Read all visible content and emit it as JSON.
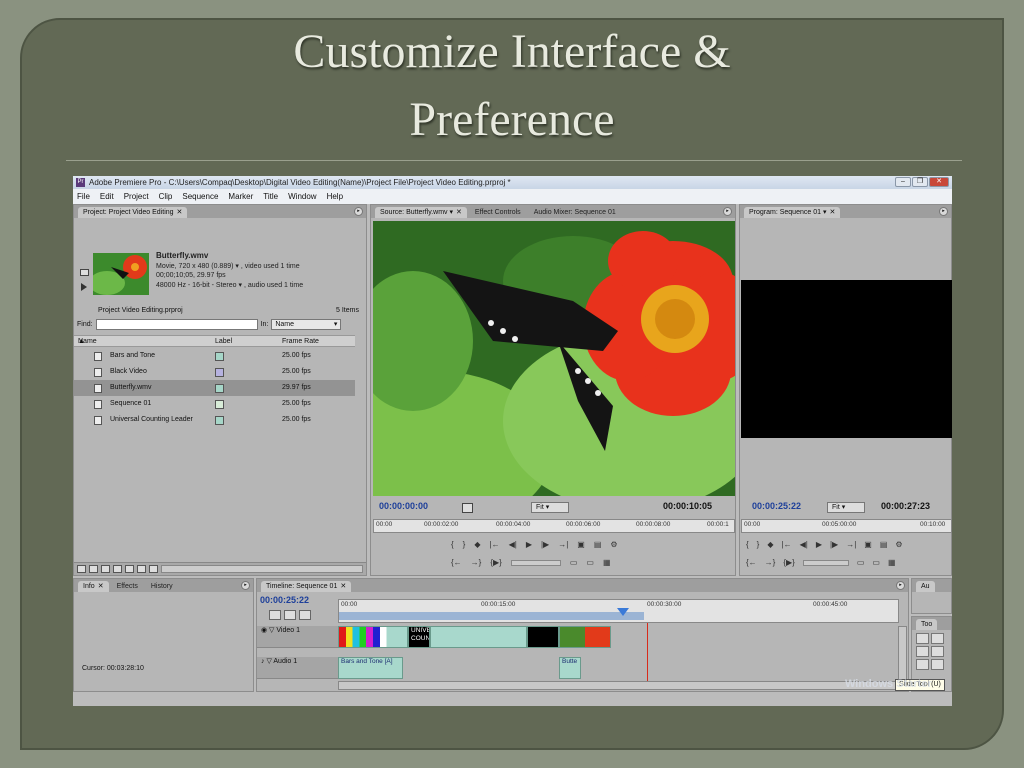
{
  "slide": {
    "title_line1": "Customize Interface &",
    "title_line2": "Preference"
  },
  "app": {
    "title_bar": "Adobe Premiere Pro - C:\\Users\\Compaq\\Desktop\\Digital Video Editing(Name)\\Project File\\Project Video Editing.prproj *",
    "icon_text": "Pr",
    "menu": [
      "File",
      "Edit",
      "Project",
      "Clip",
      "Sequence",
      "Marker",
      "Title",
      "Window",
      "Help"
    ]
  },
  "project_panel": {
    "tab": "Project: Project Video Editing",
    "clip_name": "Butterfly.wmv",
    "clip_line1": "Movie, 720 x 480 (0.889)  ▾  , video used 1 time",
    "clip_line2": "00;00;10;05, 29.97 fps",
    "clip_line3": "48000 Hz - 16-bit - Stereo  ▾  , audio used 1 time",
    "project_file": "Project Video Editing.prproj",
    "item_count": "5 Items",
    "find_label": "Find:",
    "in_label": "In:",
    "in_value": "Name",
    "col_name": "Name",
    "col_label": "Label",
    "col_frame_rate": "Frame Rate",
    "items": [
      {
        "name": "Bars and Tone",
        "fps": "25.00 fps",
        "color": "#a6d6c8"
      },
      {
        "name": "Black Video",
        "fps": "25.00 fps",
        "color": "#b6b2e0"
      },
      {
        "name": "Butterfly.wmv",
        "fps": "29.97 fps",
        "color": "#a6d6c8"
      },
      {
        "name": "Sequence 01",
        "fps": "25.00 fps",
        "color": "#d8ecd8"
      },
      {
        "name": "Universal Counting Leader",
        "fps": "25.00 fps",
        "color": "#a6d6c8"
      }
    ]
  },
  "source_monitor": {
    "tabs": [
      "Source: Butterfly.wmv",
      "Effect Controls",
      "Audio Mixer: Sequence 01"
    ],
    "timecode_current": "00:00:00:00",
    "fit": "Fit",
    "timecode_duration": "00:00:10:05",
    "ruler": [
      "00:00",
      "00:00:02:00",
      "00:00:04:00",
      "00:00:06:00",
      "00:00:08:00",
      "00:00:1"
    ]
  },
  "program_monitor": {
    "tab": "Program: Sequence 01",
    "timecode_current": "00:00:25:22",
    "fit": "Fit",
    "timecode_duration": "00:00:27:23",
    "ruler": [
      "00:00",
      "00:05:00:00",
      "00:10:00"
    ]
  },
  "info_panel": {
    "tabs": [
      "Info",
      "Effects",
      "History"
    ],
    "cursor": "Cursor: 00:03:28:10"
  },
  "timeline": {
    "tab": "Timeline: Sequence 01",
    "timecode": "00:00:25:22",
    "ruler": [
      "00:00",
      "00:00:15:00",
      "00:00:30:00",
      "00:00:45:00"
    ],
    "video_track": "Video 1",
    "audio_track": "Audio 1",
    "audio_clip1": "Bars and Tone [A]",
    "audio_clip2": "Butte",
    "video_clip_counting": "UNIVERSAL COUNTING",
    "playhead_fraction": 0.55
  },
  "tools_panel": {
    "tab": "Too",
    "tooltip": "Slide Tool (U)"
  },
  "audio_meter_tab": "Au",
  "watermark": "Windows Starter"
}
